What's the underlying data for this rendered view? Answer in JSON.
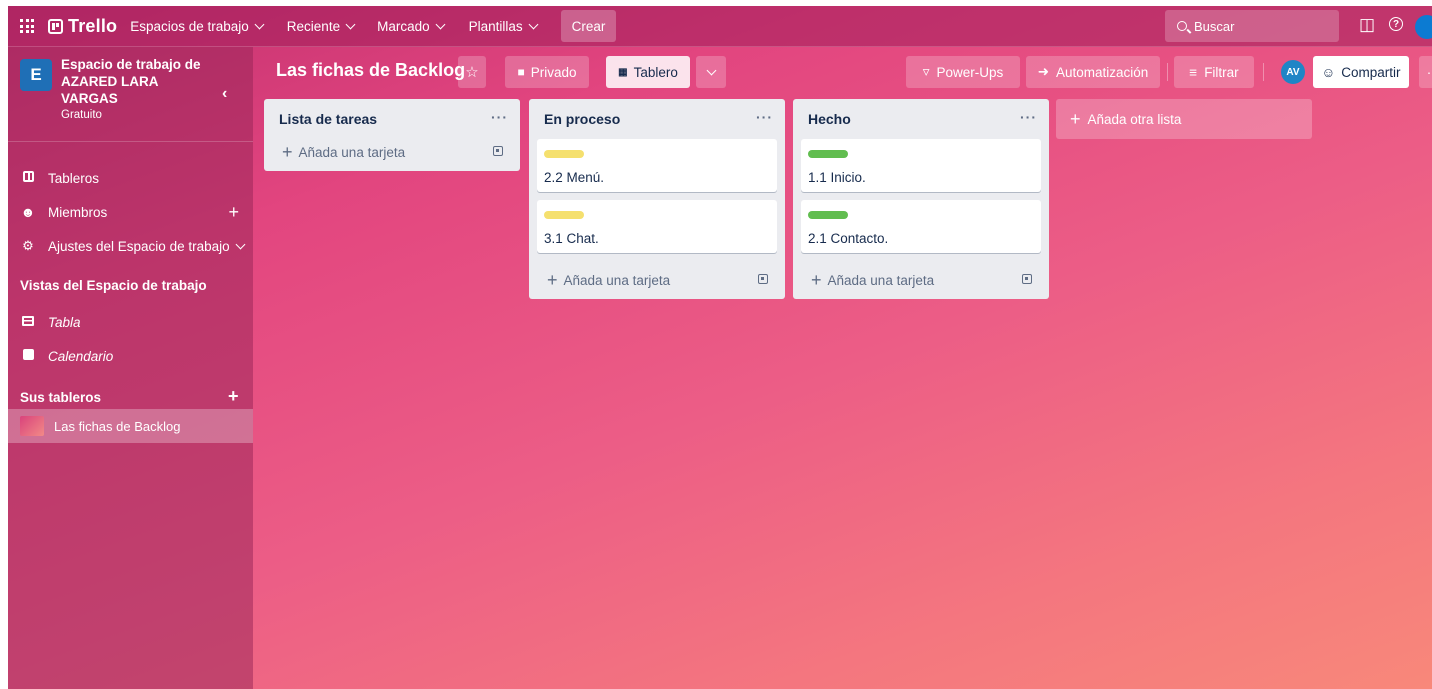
{
  "topnav": {
    "brand": "Trello",
    "menus": [
      {
        "label": "Espacios de trabajo"
      },
      {
        "label": "Reciente"
      },
      {
        "label": "Marcado"
      },
      {
        "label": "Plantillas"
      }
    ],
    "create_label": "Crear",
    "search_placeholder": "Buscar"
  },
  "sidebar": {
    "workspace_initial": "E",
    "workspace_name": "Espacio de trabajo de AZARED LARA VARGAS",
    "workspace_plan": "Gratuito",
    "items": [
      {
        "label": "Tableros",
        "icon": "board-icon"
      },
      {
        "label": "Miembros",
        "icon": "members-icon"
      },
      {
        "label": "Ajustes del Espacio de trabajo",
        "icon": "gear-icon"
      }
    ],
    "views_heading": "Vistas del Espacio de trabajo",
    "views": [
      {
        "label": "Tabla",
        "icon": "table-icon"
      },
      {
        "label": "Calendario",
        "icon": "calendar-icon"
      }
    ],
    "boards_heading": "Sus tableros",
    "boards": [
      {
        "label": "Las fichas de Backlog"
      }
    ]
  },
  "board": {
    "title": "Las fichas de Backlog",
    "visibility_label": "Privado",
    "view_label": "Tablero",
    "powerups_label": "Power-Ups",
    "automation_label": "Automatización",
    "filter_label": "Filtrar",
    "member_initials": "AV",
    "share_label": "Compartir",
    "add_list_label": "Añada otra lista",
    "lists": [
      {
        "title": "Lista de tareas",
        "cards": [],
        "add_card_label": "Añada una tarjeta"
      },
      {
        "title": "En proceso",
        "cards": [
          {
            "title": "2.2 Menú.",
            "label_color": "#f5e06e"
          },
          {
            "title": "3.1 Chat.",
            "label_color": "#f5e06e"
          }
        ],
        "add_card_label": "Añada una tarjeta"
      },
      {
        "title": "Hecho",
        "cards": [
          {
            "title": "1.1 Inicio.",
            "label_color": "#61bd4f"
          },
          {
            "title": "2.1 Contacto.",
            "label_color": "#61bd4f"
          }
        ],
        "add_card_label": "Añada una tarjeta"
      }
    ]
  }
}
